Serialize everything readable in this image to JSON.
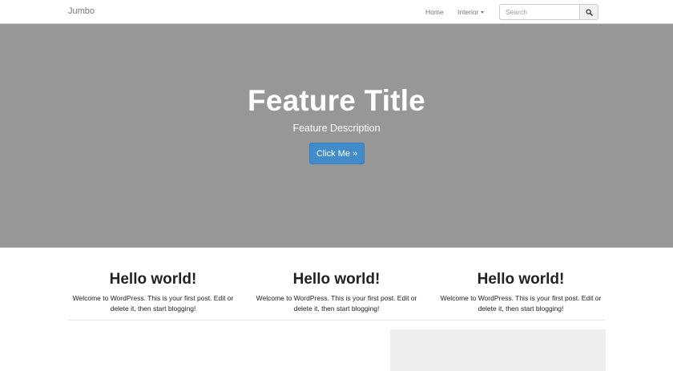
{
  "navbar": {
    "brand": "Jumbo",
    "links": [
      {
        "label": "Home"
      },
      {
        "label": "Interior"
      }
    ],
    "search": {
      "placeholder": "Search",
      "button_icon": "search-icon"
    }
  },
  "hero": {
    "title": "Feature Title",
    "description": "Feature Description",
    "button_label": "Click Me »",
    "background_color": "#979797",
    "button_color": "#428bca"
  },
  "posts": [
    {
      "title": "Hello world!",
      "excerpt": "Welcome to WordPress. This is your first post. Edit or delete it, then start blogging!"
    },
    {
      "title": "Hello world!",
      "excerpt": "Welcome to WordPress. This is your first post. Edit or delete it, then start blogging!"
    },
    {
      "title": "Hello world!",
      "excerpt": "Welcome to WordPress. This is your first post. Edit or delete it, then start blogging!"
    }
  ]
}
